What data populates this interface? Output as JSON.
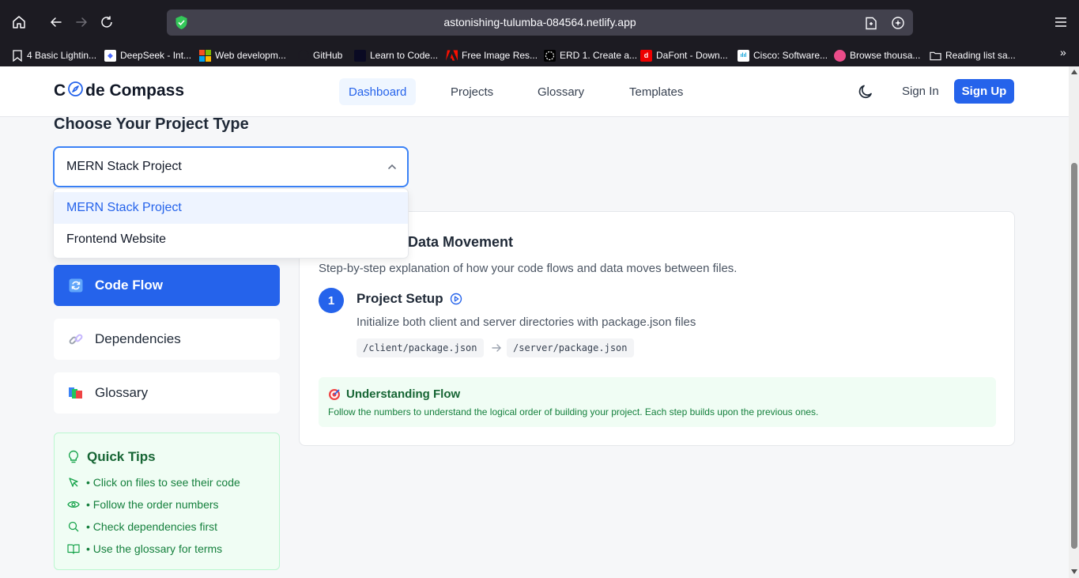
{
  "browser": {
    "url": "astonishing-tulumba-084564.netlify.app",
    "bookmarks": [
      {
        "label": "4 Basic Lightin...",
        "icon": "bookmark-outline-icon"
      },
      {
        "label": "DeepSeek - Int...",
        "icon": "deepseek-icon"
      },
      {
        "label": "Web developm...",
        "icon": "microsoft-icon"
      },
      {
        "label": "GitHub",
        "icon": "github-icon"
      },
      {
        "label": "Learn to Code...",
        "icon": "freecodecamp-icon"
      },
      {
        "label": "Free Image Res...",
        "icon": "adobe-icon"
      },
      {
        "label": "ERD 1. Create a...",
        "icon": "erd-icon"
      },
      {
        "label": "DaFont - Down...",
        "icon": "dafont-icon"
      },
      {
        "label": "Cisco: Software...",
        "icon": "cisco-icon"
      },
      {
        "label": "Browse thousa...",
        "icon": "dribbble-icon"
      },
      {
        "label": "Reading list sa...",
        "icon": "folder-icon"
      }
    ]
  },
  "header": {
    "logo_start": "C",
    "logo_end": "de Compass",
    "tabs": [
      "Dashboard",
      "Projects",
      "Glossary",
      "Templates"
    ],
    "active_tab": "Dashboard",
    "sign_in": "Sign In",
    "sign_up": "Sign Up"
  },
  "main": {
    "section_title": "Choose Your Project Type",
    "select": {
      "value": "MERN Stack Project",
      "options": [
        "MERN Stack Project",
        "Frontend Website"
      ]
    },
    "sidebar": [
      {
        "label": "Code Flow",
        "icon": "refresh-icon",
        "active": true
      },
      {
        "label": "Dependencies",
        "icon": "link-icon",
        "active": false
      },
      {
        "label": "Glossary",
        "icon": "books-icon",
        "active": false
      }
    ],
    "quick_tips": {
      "title": "Quick Tips",
      "items": [
        {
          "text": "• Click on files to see their code",
          "icon": "cursor-icon"
        },
        {
          "text": "• Follow the order numbers",
          "icon": "eye-icon"
        },
        {
          "text": "• Check dependencies first",
          "icon": "search-icon"
        },
        {
          "text": "• Use the glossary for terms",
          "icon": "book-open-icon"
        }
      ]
    },
    "card": {
      "title": "Data Movement",
      "subtitle": "Step-by-step explanation of how your code flows and data moves between files.",
      "step": {
        "number": "1",
        "title": "Project Setup",
        "description": "Initialize both client and server directories with package.json files",
        "files": [
          "/client/package.json",
          "/server/package.json"
        ]
      },
      "flow": {
        "title": "Understanding Flow",
        "text": "Follow the numbers to understand the logical order of building your project. Each step builds upon the previous ones."
      }
    }
  },
  "colors": {
    "accent": "#2563eb",
    "tip_green": "#15803d",
    "tip_bg": "#f0fdf4"
  }
}
